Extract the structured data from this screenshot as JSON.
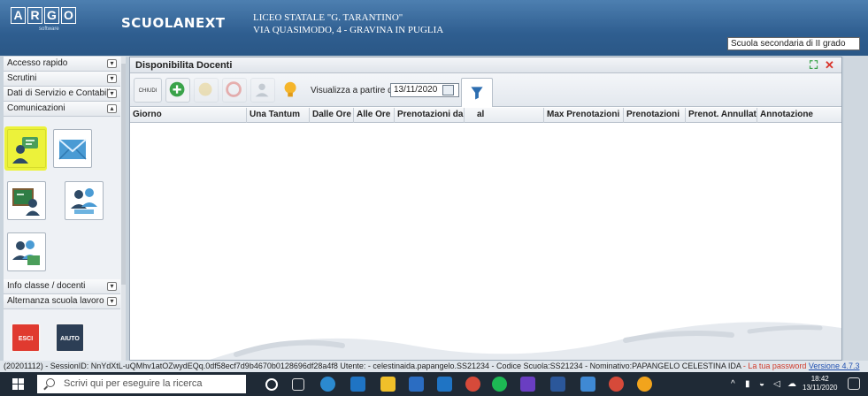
{
  "header": {
    "logo_letters": [
      "A",
      "R",
      "G",
      "O"
    ],
    "logo_sub": "software",
    "brand": "SCUOLANEXT",
    "school_name": "LICEO STATALE \"G. TARANTINO\"",
    "school_address": "VIA QUASIMODO, 4 - GRAVINA IN PUGLIA",
    "school_type": "Scuola secondaria di II grado"
  },
  "sidebar": {
    "items": [
      {
        "label": "Accesso rapido"
      },
      {
        "label": "Scrutini"
      },
      {
        "label": "Dati di Servizio e Contabili"
      },
      {
        "label": "Comunicazioni"
      },
      {
        "label": "Info classe / docenti"
      },
      {
        "label": "Alternanza scuola lavoro"
      }
    ],
    "exit_label": "ESCI",
    "help_label": "AIUTO"
  },
  "panel": {
    "title": "Disponibilita Docenti",
    "close_label": "CHIUDI",
    "date_label": "Visualizza a partire dal:",
    "date_value": "13/11/2020",
    "columns": [
      "Giorno",
      "Una Tantum",
      "Dalle Ore",
      "Alle Ore",
      "Prenotazioni dal",
      "al",
      "Max Prenotazioni",
      "Prenotazioni",
      "Prenot. Annullate",
      "Annotazione"
    ]
  },
  "status": {
    "session": "(20201112) - SessionID: NnYdXtL-uQMhv1atOZwydEQq.0df58ecf7d9b4670b0128696df28a4f8 Utente: - celestinaida.papangelo.SS21234 - Codice Scuola:SS21234 - Nominativo:PAPANGELO CELESTINA IDA",
    "warning": "- La tua password",
    "version": "Versione 4.7.3"
  },
  "taskbar": {
    "search_placeholder": "Scrivi qui per eseguire la ricerca",
    "time": "18:42",
    "date": "13/11/2020"
  },
  "colors": {
    "header_blue": "#2f5e90",
    "highlight": "#ecf23a",
    "exit_red": "#e03a2f"
  }
}
